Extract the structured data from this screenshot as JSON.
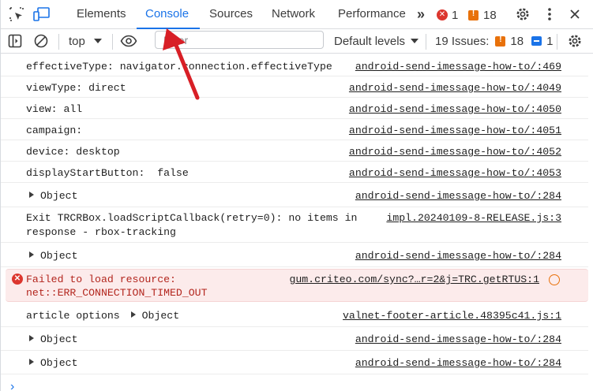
{
  "tabs": [
    {
      "label": "Elements"
    },
    {
      "label": "Console"
    },
    {
      "label": "Sources"
    },
    {
      "label": "Network"
    },
    {
      "label": "Performance"
    }
  ],
  "tabbar": {
    "more_glyph": "»",
    "error_count": "1",
    "warning_count": "18"
  },
  "toolbar": {
    "context": "top",
    "filter_placeholder": "Filter",
    "levels": "Default levels",
    "issues_label": "19 Issues:",
    "issues_warn": "18",
    "issues_info": "1"
  },
  "log": [
    {
      "msg": "effectiveType: navigator.connection.effectiveType",
      "src": "android-send-imessage-how-to/:469"
    },
    {
      "msg": "viewType: direct",
      "src": "android-send-imessage-how-to/:4049"
    },
    {
      "msg": "view: all",
      "src": "android-send-imessage-how-to/:4050"
    },
    {
      "msg": "campaign:",
      "src": "android-send-imessage-how-to/:4051"
    },
    {
      "msg": "device: desktop",
      "src": "android-send-imessage-how-to/:4052"
    },
    {
      "msg": "displayStartButton:  false",
      "src": "android-send-imessage-how-to/:4053"
    },
    {
      "msg": "Object",
      "src": "android-send-imessage-how-to/:284"
    },
    {
      "msg": "Exit TRCRBox.loadScriptCallback(retry=0): no items in",
      "msg2": "response - rbox-tracking",
      "src": "impl.20240109-8-RELEASE.js:3"
    },
    {
      "msg": "Object",
      "src": "android-send-imessage-how-to/:284"
    },
    {
      "msg": "Failed to load resource:",
      "msg2": "net::ERR_CONNECTION_TIMED_OUT",
      "src": "gum.criteo.com/sync?…r=2&j=TRC.getRTUS:1"
    },
    {
      "msg": "article options",
      "msg_obj": "Object",
      "src": "valnet-footer-article.48395c41.js:1"
    },
    {
      "msg": "Object",
      "src": "android-send-imessage-how-to/:284"
    },
    {
      "msg": "Object",
      "src": "android-send-imessage-how-to/:284"
    }
  ],
  "prompt": "›",
  "colors": {
    "accent": "#1a73e8",
    "error": "#dc362e",
    "warning": "#e8710a",
    "arrow": "#d81f26",
    "error_bg": "#fcebeb"
  }
}
